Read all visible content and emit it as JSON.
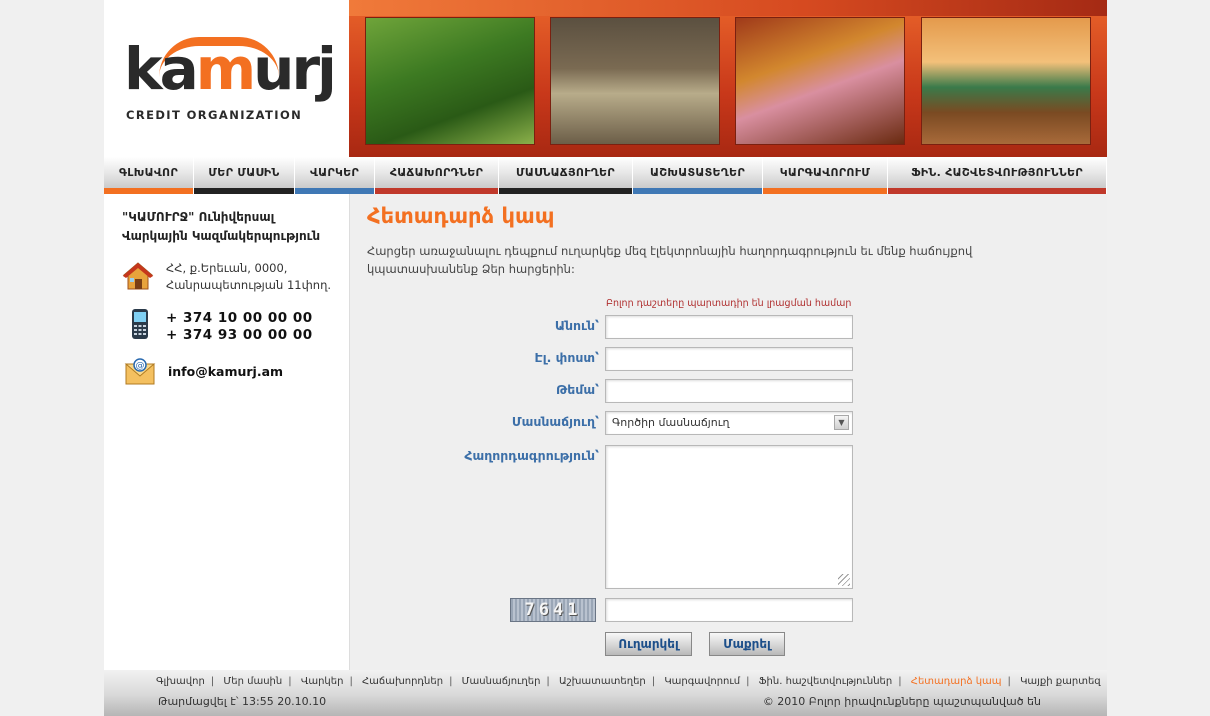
{
  "brand": {
    "logo_text_1": "ka",
    "logo_text_m": "m",
    "logo_text_2": "urj",
    "logo_subtitle": "CREDIT ORGANIZATION"
  },
  "banner": {
    "photos": [
      {
        "name": "greenhouse-farmer-photo"
      },
      {
        "name": "ducklings-photo"
      },
      {
        "name": "market-vendor-photo"
      },
      {
        "name": "tractor-field-photo"
      }
    ]
  },
  "nav": {
    "items": [
      {
        "label": "ԳԼԽԱՎՈՐ",
        "bar": "#f37021"
      },
      {
        "label": "ՄԵՐ ՄԱՍԻՆ",
        "bar": "#222222"
      },
      {
        "label": "ՎԱՐԿԵՐ",
        "bar": "#3f78b5"
      },
      {
        "label": "ՀԱՃԱԽՈՐԴՆԵՐ",
        "bar": "#c0392b"
      },
      {
        "label": "ՄԱՍՆԱՃՅՈՒՂԵՐ",
        "bar": "#222222"
      },
      {
        "label": "ԱՇԽԱՏԱՏԵՂԵՐ",
        "bar": "#3f78b5"
      },
      {
        "label": "ԿԱՐԳԱՎՈՐՈՒՄ",
        "bar": "#f37021"
      },
      {
        "label": "ՖԻՆ. ՀԱՇՎԵՏՎՈՒԹՅՈՒՆՆԵՐ",
        "bar": "#c0392b"
      }
    ]
  },
  "contact": {
    "org_line1": "\"ԿԱՄՈՒՐՋ\" Ունիվերսալ",
    "org_line2": "Վարկային Կազմակերպություն",
    "address_line1": "ՀՀ, ք.Երեւան, 0000,",
    "address_line2": "Հանրապետության 11փող.",
    "phone1": "+ 374 10 00 00 00",
    "phone2": "+ 374 93 00 00 00",
    "email": "info@kamurj.am"
  },
  "form": {
    "title": "Հետադարձ կապ",
    "intro": "Հարցեր առաջանալու դեպքում ուղարկեք մեզ էլեկտրոնային հաղորդագրություն եւ մենք հաճույքով կպատասխանենք Ձեր հարցերին:",
    "required_note": "Բոլոր դաշտերը պարտադիր են լրացման համար",
    "name_label": "Անուն՝",
    "email_label": "Էլ. փոստ՝",
    "subject_label": "Թեմա՝",
    "branch_label": "Մասնաճյուղ՝",
    "branch_selected": "Գործիր մասնաճյուղ",
    "message_label": "Հաղորդագրություն՝",
    "captcha_code": "7641",
    "submit_label": "Ուղարկել",
    "clear_label": "Մաքրել"
  },
  "footer": {
    "links": [
      "Գլխավոր",
      "Մեր մասին",
      "Վարկեր",
      "Հաճախորդներ",
      "Մասնաճյուղեր",
      "Աշխատատեղեր",
      "Կարգավորում",
      "Ֆին. հաշվետվություններ",
      "Հետադարձ կապ",
      "Կայքի քարտեզ"
    ],
    "active_link": "Հետադարձ կապ",
    "updated": "Թարմացվել է՝ 13:55  20.10.10",
    "copyright": "© 2010 Բոլոր իրավունքները պաշտպանված են"
  }
}
